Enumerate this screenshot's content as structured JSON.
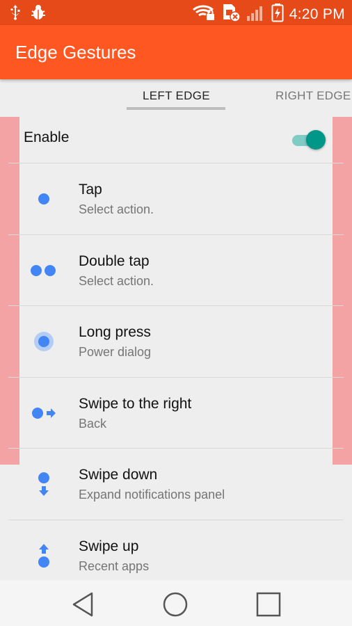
{
  "status_bar": {
    "time": "4:20 PM",
    "left_icons": [
      "usb-icon",
      "bug-icon"
    ],
    "right_icons": [
      "wifi-lock-icon",
      "sim-error-icon",
      "signal-icon",
      "battery-charging-icon"
    ]
  },
  "app_bar": {
    "title": "Edge Gestures"
  },
  "tabs": [
    {
      "label": "LEFT EDGE",
      "selected": true
    },
    {
      "label": "RIGHT EDGE",
      "selected": false
    }
  ],
  "enable": {
    "label": "Enable",
    "on": true
  },
  "gestures": [
    {
      "title": "Tap",
      "subtitle": "Select action.",
      "icon": "tap-icon"
    },
    {
      "title": "Double tap",
      "subtitle": "Select action.",
      "icon": "double-tap-icon"
    },
    {
      "title": "Long press",
      "subtitle": "Power dialog",
      "icon": "long-press-icon"
    },
    {
      "title": "Swipe to the right",
      "subtitle": "Back",
      "icon": "swipe-right-icon"
    },
    {
      "title": "Swipe down",
      "subtitle": "Expand notifications panel",
      "icon": "swipe-down-icon"
    },
    {
      "title": "Swipe up",
      "subtitle": "Recent apps",
      "icon": "swipe-up-icon"
    }
  ],
  "nav": [
    "back-icon",
    "home-icon",
    "recents-icon"
  ],
  "colors": {
    "status_bar": "#e64a19",
    "app_bar": "#ff5722",
    "edge_highlight": "#f4a3a5",
    "gesture_dot": "#4285f4",
    "toggle_on": "#009688"
  }
}
